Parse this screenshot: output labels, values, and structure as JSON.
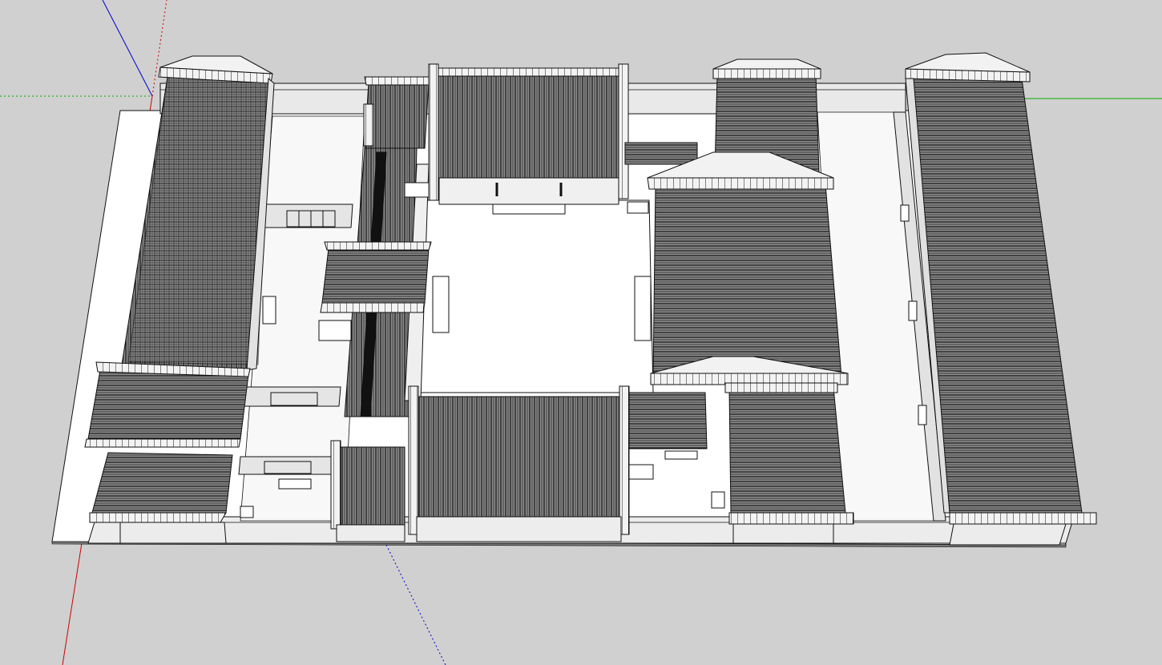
{
  "app": {
    "view": "3d-model-viewport",
    "background_color": "#d0d0d0"
  },
  "colors": {
    "ground": "#ffffff",
    "wall_face": "#e8e8e8",
    "wall_top": "#f4f4f4",
    "roof_fill": "#6e6e6e",
    "roof_line": "#1a1a1a",
    "ridge": "#f2f2f2",
    "edge": "#111111",
    "axis_red": "#cc0000",
    "axis_green": "#00aa00",
    "axis_blue": "#0000cc"
  },
  "scene": {
    "model": "courtyard-compound",
    "axes": [
      "red-axis",
      "green-axis",
      "blue-axis"
    ],
    "buildings": [
      "west-hall",
      "east-hall",
      "north-main-hall",
      "north-east-wing",
      "north-west-wing",
      "south-gate-hall",
      "south-west-wing",
      "east-side-hall",
      "south-east-wing",
      "west-corridor",
      "west-pavilion",
      "south-west-small-hall"
    ]
  }
}
